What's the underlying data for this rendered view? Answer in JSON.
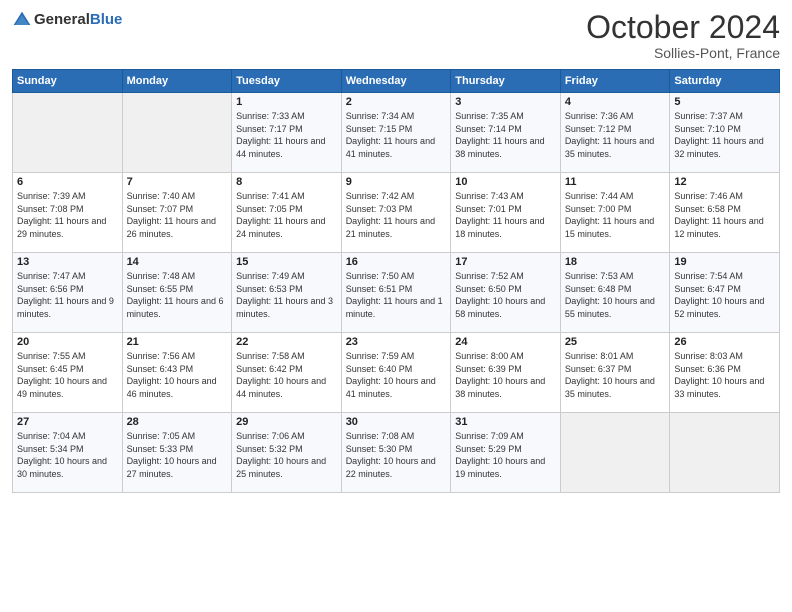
{
  "logo": {
    "general": "General",
    "blue": "Blue"
  },
  "title": "October 2024",
  "location": "Sollies-Pont, France",
  "days_of_week": [
    "Sunday",
    "Monday",
    "Tuesday",
    "Wednesday",
    "Thursday",
    "Friday",
    "Saturday"
  ],
  "weeks": [
    [
      {
        "day": "",
        "info": ""
      },
      {
        "day": "",
        "info": ""
      },
      {
        "day": "1",
        "info": "Sunrise: 7:33 AM\nSunset: 7:17 PM\nDaylight: 11 hours and 44 minutes."
      },
      {
        "day": "2",
        "info": "Sunrise: 7:34 AM\nSunset: 7:15 PM\nDaylight: 11 hours and 41 minutes."
      },
      {
        "day": "3",
        "info": "Sunrise: 7:35 AM\nSunset: 7:14 PM\nDaylight: 11 hours and 38 minutes."
      },
      {
        "day": "4",
        "info": "Sunrise: 7:36 AM\nSunset: 7:12 PM\nDaylight: 11 hours and 35 minutes."
      },
      {
        "day": "5",
        "info": "Sunrise: 7:37 AM\nSunset: 7:10 PM\nDaylight: 11 hours and 32 minutes."
      }
    ],
    [
      {
        "day": "6",
        "info": "Sunrise: 7:39 AM\nSunset: 7:08 PM\nDaylight: 11 hours and 29 minutes."
      },
      {
        "day": "7",
        "info": "Sunrise: 7:40 AM\nSunset: 7:07 PM\nDaylight: 11 hours and 26 minutes."
      },
      {
        "day": "8",
        "info": "Sunrise: 7:41 AM\nSunset: 7:05 PM\nDaylight: 11 hours and 24 minutes."
      },
      {
        "day": "9",
        "info": "Sunrise: 7:42 AM\nSunset: 7:03 PM\nDaylight: 11 hours and 21 minutes."
      },
      {
        "day": "10",
        "info": "Sunrise: 7:43 AM\nSunset: 7:01 PM\nDaylight: 11 hours and 18 minutes."
      },
      {
        "day": "11",
        "info": "Sunrise: 7:44 AM\nSunset: 7:00 PM\nDaylight: 11 hours and 15 minutes."
      },
      {
        "day": "12",
        "info": "Sunrise: 7:46 AM\nSunset: 6:58 PM\nDaylight: 11 hours and 12 minutes."
      }
    ],
    [
      {
        "day": "13",
        "info": "Sunrise: 7:47 AM\nSunset: 6:56 PM\nDaylight: 11 hours and 9 minutes."
      },
      {
        "day": "14",
        "info": "Sunrise: 7:48 AM\nSunset: 6:55 PM\nDaylight: 11 hours and 6 minutes."
      },
      {
        "day": "15",
        "info": "Sunrise: 7:49 AM\nSunset: 6:53 PM\nDaylight: 11 hours and 3 minutes."
      },
      {
        "day": "16",
        "info": "Sunrise: 7:50 AM\nSunset: 6:51 PM\nDaylight: 11 hours and 1 minute."
      },
      {
        "day": "17",
        "info": "Sunrise: 7:52 AM\nSunset: 6:50 PM\nDaylight: 10 hours and 58 minutes."
      },
      {
        "day": "18",
        "info": "Sunrise: 7:53 AM\nSunset: 6:48 PM\nDaylight: 10 hours and 55 minutes."
      },
      {
        "day": "19",
        "info": "Sunrise: 7:54 AM\nSunset: 6:47 PM\nDaylight: 10 hours and 52 minutes."
      }
    ],
    [
      {
        "day": "20",
        "info": "Sunrise: 7:55 AM\nSunset: 6:45 PM\nDaylight: 10 hours and 49 minutes."
      },
      {
        "day": "21",
        "info": "Sunrise: 7:56 AM\nSunset: 6:43 PM\nDaylight: 10 hours and 46 minutes."
      },
      {
        "day": "22",
        "info": "Sunrise: 7:58 AM\nSunset: 6:42 PM\nDaylight: 10 hours and 44 minutes."
      },
      {
        "day": "23",
        "info": "Sunrise: 7:59 AM\nSunset: 6:40 PM\nDaylight: 10 hours and 41 minutes."
      },
      {
        "day": "24",
        "info": "Sunrise: 8:00 AM\nSunset: 6:39 PM\nDaylight: 10 hours and 38 minutes."
      },
      {
        "day": "25",
        "info": "Sunrise: 8:01 AM\nSunset: 6:37 PM\nDaylight: 10 hours and 35 minutes."
      },
      {
        "day": "26",
        "info": "Sunrise: 8:03 AM\nSunset: 6:36 PM\nDaylight: 10 hours and 33 minutes."
      }
    ],
    [
      {
        "day": "27",
        "info": "Sunrise: 7:04 AM\nSunset: 5:34 PM\nDaylight: 10 hours and 30 minutes."
      },
      {
        "day": "28",
        "info": "Sunrise: 7:05 AM\nSunset: 5:33 PM\nDaylight: 10 hours and 27 minutes."
      },
      {
        "day": "29",
        "info": "Sunrise: 7:06 AM\nSunset: 5:32 PM\nDaylight: 10 hours and 25 minutes."
      },
      {
        "day": "30",
        "info": "Sunrise: 7:08 AM\nSunset: 5:30 PM\nDaylight: 10 hours and 22 minutes."
      },
      {
        "day": "31",
        "info": "Sunrise: 7:09 AM\nSunset: 5:29 PM\nDaylight: 10 hours and 19 minutes."
      },
      {
        "day": "",
        "info": ""
      },
      {
        "day": "",
        "info": ""
      }
    ]
  ]
}
